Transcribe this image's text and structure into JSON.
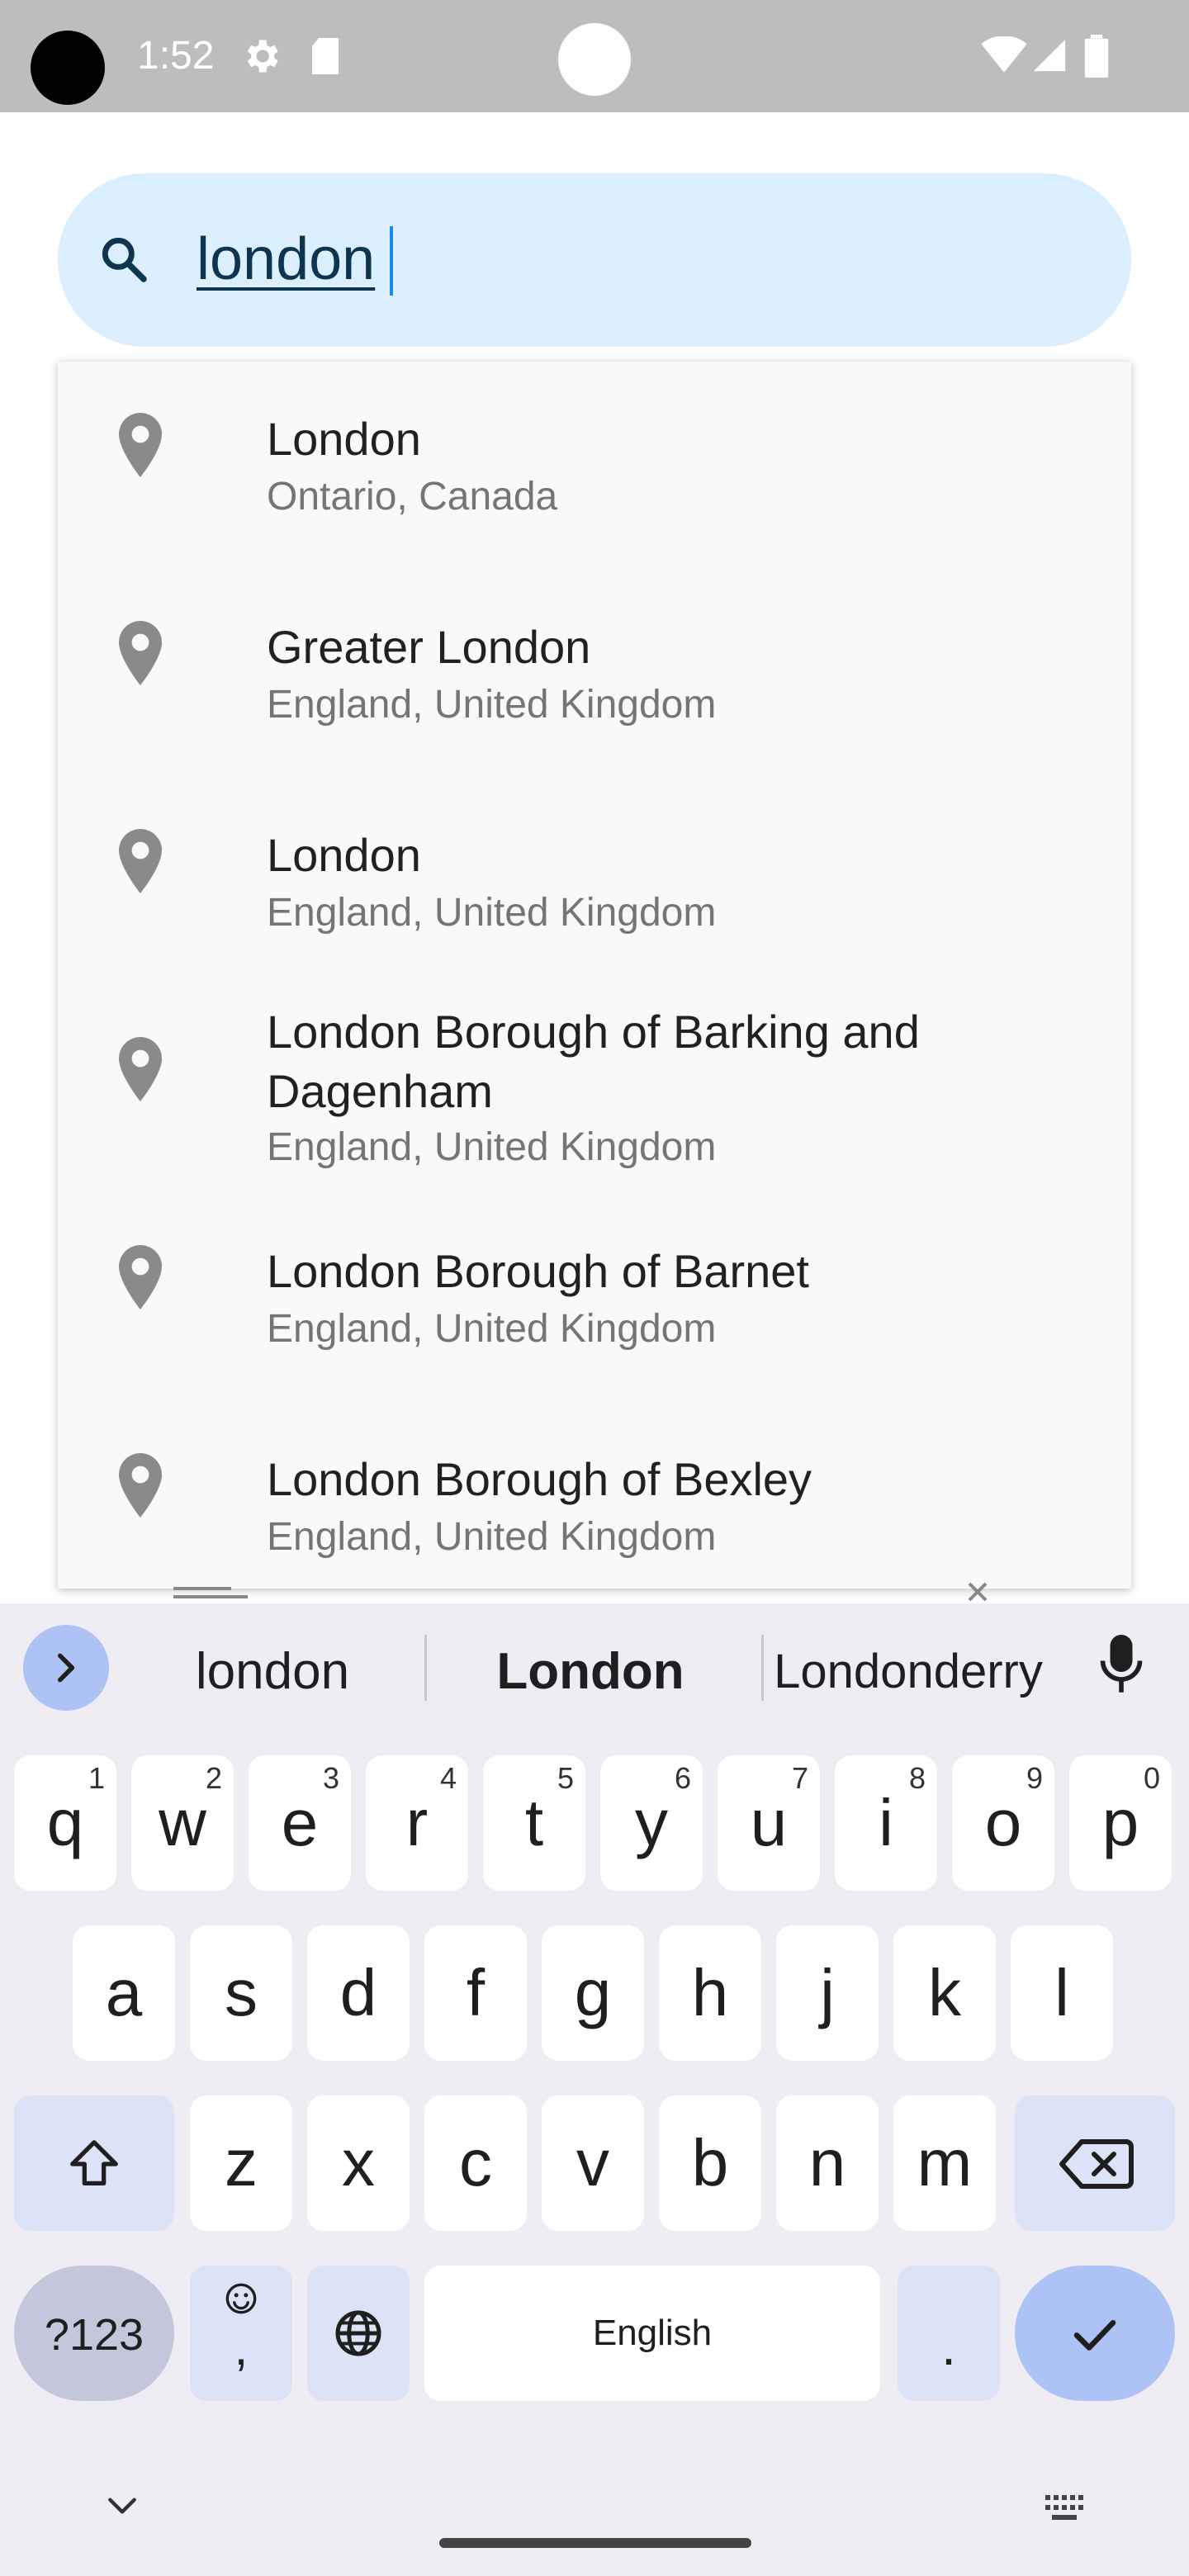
{
  "status_bar": {
    "time": "1:52"
  },
  "search": {
    "query": "london"
  },
  "suggestions": [
    {
      "title": "London",
      "subtitle": "Ontario, Canada"
    },
    {
      "title": "Greater London",
      "subtitle": "England, United Kingdom"
    },
    {
      "title": "London",
      "subtitle": "England, United Kingdom"
    },
    {
      "title": "London Borough of Barking and Dagenham",
      "subtitle": "England, United Kingdom"
    },
    {
      "title": "London Borough of Barnet",
      "subtitle": "England, United Kingdom"
    },
    {
      "title": "London Borough of Bexley",
      "subtitle": "England, United Kingdom"
    }
  ],
  "keyboard": {
    "suggestions": [
      "london",
      "London",
      "Londonderry"
    ],
    "row1": [
      [
        "q",
        "1"
      ],
      [
        "w",
        "2"
      ],
      [
        "e",
        "3"
      ],
      [
        "r",
        "4"
      ],
      [
        "t",
        "5"
      ],
      [
        "y",
        "6"
      ],
      [
        "u",
        "7"
      ],
      [
        "i",
        "8"
      ],
      [
        "o",
        "9"
      ],
      [
        "p",
        "0"
      ]
    ],
    "row2": [
      "a",
      "s",
      "d",
      "f",
      "g",
      "h",
      "j",
      "k",
      "l"
    ],
    "row3": [
      "z",
      "x",
      "c",
      "v",
      "b",
      "n",
      "m"
    ],
    "symbols_label": "?123",
    "comma": ",",
    "space_label": "English",
    "period": "."
  },
  "colors": {
    "search_bg": "#dcefff",
    "accent_key": "#adc2f5",
    "keyboard_bg": "#efecf4"
  }
}
